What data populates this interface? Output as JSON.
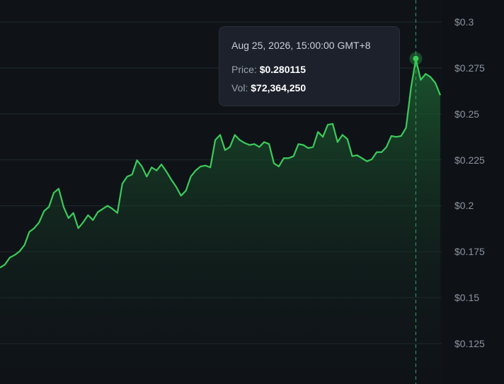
{
  "chart_data": {
    "type": "area",
    "y_axis": {
      "ticks": [
        {
          "value": 0.3,
          "label": "$0.3"
        },
        {
          "value": 0.275,
          "label": "$0.275"
        },
        {
          "value": 0.25,
          "label": "$0.25"
        },
        {
          "value": 0.225,
          "label": "$0.225"
        },
        {
          "value": 0.2,
          "label": "$0.2"
        },
        {
          "value": 0.175,
          "label": "$0.175"
        },
        {
          "value": 0.15,
          "label": "$0.15"
        },
        {
          "value": 0.125,
          "label": "$0.125"
        }
      ],
      "ylim": [
        0.103,
        0.312
      ],
      "position": "right"
    },
    "grid": true,
    "series": [
      {
        "values": [
          0.1663,
          0.168,
          0.1718,
          0.1732,
          0.1752,
          0.1786,
          0.1858,
          0.1878,
          0.191,
          0.1971,
          0.1994,
          0.2071,
          0.2093,
          0.1994,
          0.1933,
          0.1961,
          0.1878,
          0.191,
          0.1949,
          0.1922,
          0.1966,
          0.1983,
          0.2,
          0.1983,
          0.1961,
          0.212,
          0.2159,
          0.217,
          0.2248,
          0.2214,
          0.2159,
          0.2209,
          0.2192,
          0.2225,
          0.2187,
          0.2143,
          0.2104,
          0.2055,
          0.2082,
          0.2159,
          0.2192,
          0.2214,
          0.2219,
          0.2209,
          0.2358,
          0.2386,
          0.2303,
          0.232,
          0.2386,
          0.2358,
          0.2342,
          0.2331,
          0.2336,
          0.232,
          0.2347,
          0.2336,
          0.2231,
          0.2214,
          0.2259,
          0.2259,
          0.227,
          0.2336,
          0.2331,
          0.2314,
          0.232,
          0.2402,
          0.2375,
          0.2441,
          0.2446,
          0.2347,
          0.2386,
          0.2364,
          0.227,
          0.2275,
          0.2259,
          0.2242,
          0.2253,
          0.2292,
          0.2292,
          0.232,
          0.238,
          0.2375,
          0.238,
          0.2424,
          0.264,
          0.2798,
          0.2685,
          0.2718,
          0.2701,
          0.2668,
          0.2602
        ],
        "color": "#3ccb5a"
      }
    ],
    "highlight": {
      "index": 85,
      "value": 0.280115,
      "color": "#3ccb5a"
    },
    "colors": {
      "background": "#0f1318",
      "grid": "#1f2b2a",
      "crosshair": "#2fa45a",
      "fill_top": "#1e6a34"
    }
  },
  "tooltip": {
    "date": "Aug 25, 2026, 15:00:00 GMT+8",
    "price_label": "Price: ",
    "price_value": "$0.280115",
    "vol_label": "Vol: ",
    "vol_value": "$72,364,250"
  }
}
